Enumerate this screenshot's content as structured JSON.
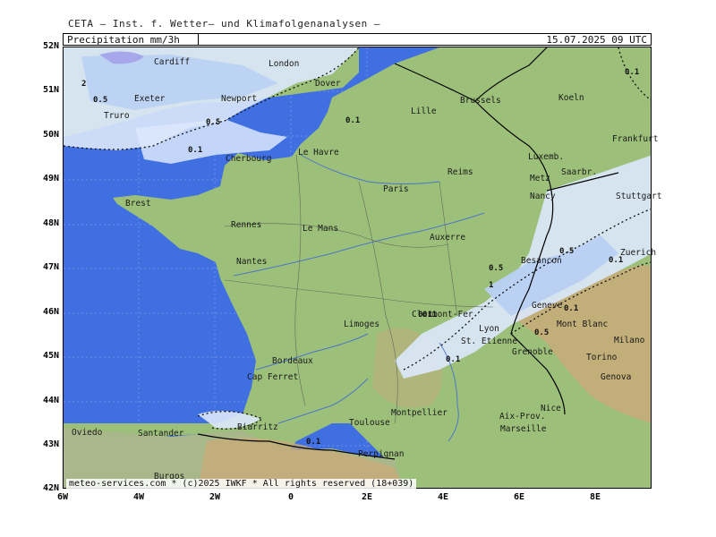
{
  "header": {
    "source": "CETA – Inst. f. Wetter– und Klimafolgenanalysen –",
    "product": "Precipitation  mm/3h",
    "valid_time": "15.07.2025  09  UTC"
  },
  "footer": "meteo-services.com * (c)2025 IWKF * All rights reserved (18+039)",
  "axes": {
    "lat": [
      "52N",
      "51N",
      "50N",
      "49N",
      "48N",
      "47N",
      "46N",
      "45N",
      "44N",
      "43N",
      "42N"
    ],
    "lon": [
      "6W",
      "4W",
      "2W",
      "0",
      "2E",
      "4E",
      "6E",
      "8E"
    ]
  },
  "colors": {
    "ocean": "#3f6fe0",
    "land": "#9cc07a",
    "precip_light": "#dbe8fb",
    "precip_mid": "#b9d0f3",
    "precip_heavy": "#a7a7ec",
    "mountain": "#c8aa78"
  },
  "cities": [
    {
      "name": "Cardiff"
    },
    {
      "name": "London"
    },
    {
      "name": "Dover"
    },
    {
      "name": "Exeter"
    },
    {
      "name": "Newport"
    },
    {
      "name": "Truro"
    },
    {
      "name": "Lille"
    },
    {
      "name": "Brussels"
    },
    {
      "name": "Koeln"
    },
    {
      "name": "Frankfurt"
    },
    {
      "name": "Le Havre"
    },
    {
      "name": "Cherbourg"
    },
    {
      "name": "Reims"
    },
    {
      "name": "Luxemb."
    },
    {
      "name": "Metz"
    },
    {
      "name": "Saarbr."
    },
    {
      "name": "Paris"
    },
    {
      "name": "Nancy"
    },
    {
      "name": "Stuttgart"
    },
    {
      "name": "Brest"
    },
    {
      "name": "Rennes"
    },
    {
      "name": "Le Mans"
    },
    {
      "name": "Auxerre"
    },
    {
      "name": "Nantes"
    },
    {
      "name": "Besancon"
    },
    {
      "name": "Zuerich"
    },
    {
      "name": "Limoges"
    },
    {
      "name": "Clermont-Fer"
    },
    {
      "name": "Geneve"
    },
    {
      "name": "Mont Blanc"
    },
    {
      "name": "Lyon"
    },
    {
      "name": "St. Etienne"
    },
    {
      "name": "Milano"
    },
    {
      "name": "Bordeaux"
    },
    {
      "name": "Grenoble"
    },
    {
      "name": "Torino"
    },
    {
      "name": "Cap Ferret"
    },
    {
      "name": "Genova"
    },
    {
      "name": "Nice"
    },
    {
      "name": "Montpellier"
    },
    {
      "name": "Aix-Prov."
    },
    {
      "name": "Toulouse"
    },
    {
      "name": "Marseille"
    },
    {
      "name": "Oviedo"
    },
    {
      "name": "Santander"
    },
    {
      "name": "Biarritz"
    },
    {
      "name": "Perpignan"
    },
    {
      "name": "Burgos"
    }
  ],
  "contour_labels": [
    "0.1",
    "0.5",
    "2",
    "0.5",
    "0.1",
    "0.1",
    "0.1",
    "0.1",
    "0.5",
    "0.5",
    "1",
    "0.1",
    "0.5",
    "0.1",
    "0.1",
    "0.1"
  ]
}
